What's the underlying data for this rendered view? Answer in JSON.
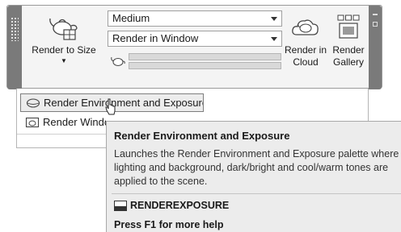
{
  "ribbon": {
    "render_to_size_label": "Render to Size",
    "render_quality_value": "Medium",
    "render_target_value": "Render in Window",
    "render_in_cloud_label": "Render in Cloud",
    "render_gallery_label": "Render Gallery"
  },
  "dropdown": {
    "items": [
      {
        "label": "Render Environment and Exposure",
        "icon": "sphere-icon",
        "highlighted": true
      },
      {
        "label": "Render Window",
        "icon": "render-window-icon",
        "highlighted": false
      }
    ]
  },
  "tooltip": {
    "title": "Render Environment and Exposure",
    "description": "Launches the Render Environment and Exposure palette where lighting and background, dark/bright and cool/warm tones  are applied to the scene.",
    "command": "RENDEREXPOSURE",
    "help": "Press F1 for more help"
  },
  "colors": {
    "panel_grip": "#7a7a7a",
    "panel_background": "#f4f4f4",
    "tooltip_background": "#ececec"
  }
}
